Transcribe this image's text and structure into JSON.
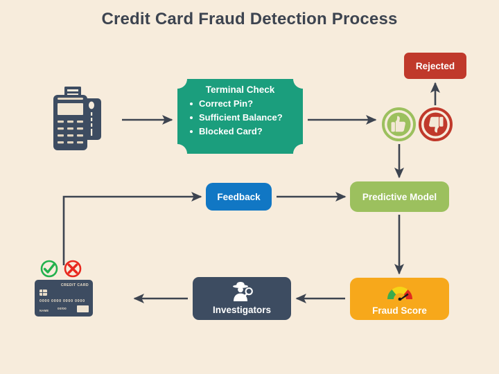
{
  "page": {
    "title": "Credit Card Fraud Detection Process",
    "background_color": "#f7ecdc",
    "title_color": "#3d4450"
  },
  "nodes": {
    "terminal_check": {
      "title": "Terminal Check",
      "color": "#1b9e7d",
      "items": [
        "Correct Pin?",
        "Sufficient Balance?",
        "Blocked Card?"
      ]
    },
    "rejected": {
      "label": "Rejected",
      "color": "#c0392b"
    },
    "feedback": {
      "label": "Feedback",
      "color": "#1177c4"
    },
    "predictive_model": {
      "label": "Predictive Model",
      "color": "#9cc05e"
    },
    "fraud_score": {
      "label": "Fraud Score",
      "color": "#f7a81b"
    },
    "investigators": {
      "label": "Investigators",
      "color": "#3d4c61"
    }
  },
  "icons": {
    "pos_terminal": "payment-terminal-icon",
    "thumbs_up": "thumbs-up-icon",
    "thumbs_down": "thumbs-down-icon",
    "gauge": "fraud-gauge-icon",
    "detective": "detective-icon",
    "check_mark": "check-circle-icon",
    "cross_mark": "cross-circle-icon"
  },
  "credit_card": {
    "brand_text": "CREDIT CARD",
    "number": "0000 0000 0000 0000",
    "name_label": "NAME",
    "expiry": "00/00",
    "color": "#3d4c61"
  },
  "colors": {
    "arrow": "#3d4450",
    "thumbs_up": "#9cc05e",
    "thumbs_down": "#c0392b",
    "gauge_green": "#3aab4d",
    "gauge_yellow": "#f6d417",
    "gauge_red": "#e02b1f",
    "check_green": "#22b14c",
    "cross_red": "#e8281e"
  },
  "flow": {
    "edges": [
      {
        "from": "payment-terminal",
        "to": "terminal-check"
      },
      {
        "from": "terminal-check",
        "to": "decision-thumbs"
      },
      {
        "from": "thumbs-down",
        "to": "rejected"
      },
      {
        "from": "thumbs-up",
        "to": "predictive-model"
      },
      {
        "from": "predictive-model",
        "to": "fraud-score"
      },
      {
        "from": "fraud-score",
        "to": "investigators"
      },
      {
        "from": "investigators",
        "to": "credit-card"
      },
      {
        "from": "credit-card",
        "to": "feedback"
      },
      {
        "from": "feedback",
        "to": "predictive-model"
      }
    ]
  }
}
